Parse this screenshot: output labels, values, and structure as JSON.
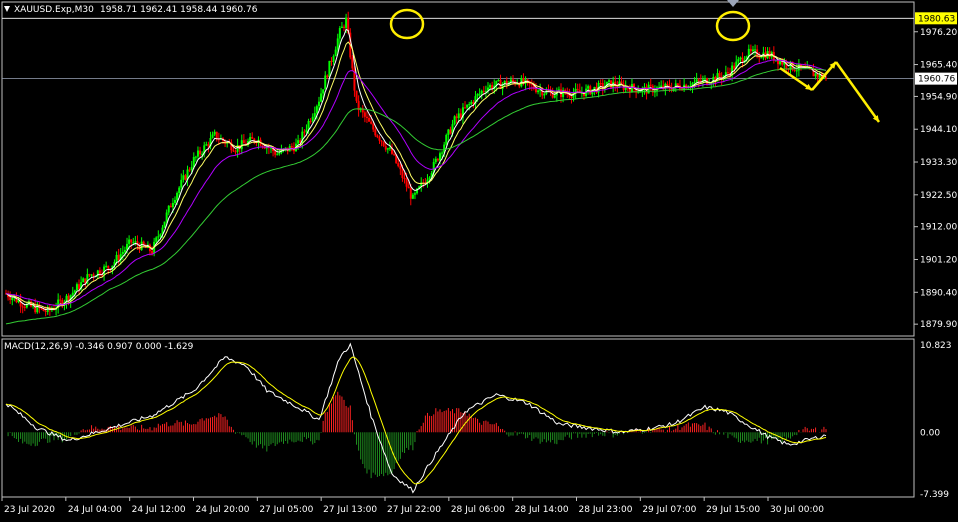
{
  "window": {
    "symbol_timeframe": "XAUUSD.Exp,M30",
    "ohlc": "1958.71 1962.41 1958.44 1960.76"
  },
  "price_axis": {
    "ticks": [
      "1976.20",
      "1965.40",
      "1954.90",
      "1944.10",
      "1933.30",
      "1922.50",
      "1912.00",
      "1901.20",
      "1890.40",
      "1879.90"
    ],
    "tick_values": [
      1976.2,
      1965.4,
      1954.9,
      1944.1,
      1933.3,
      1922.5,
      1912.0,
      1901.2,
      1890.4,
      1879.9
    ],
    "high_label": "1980.63",
    "current_label": "1960.76"
  },
  "macd": {
    "label": "MACD(12,26,9) -0.346 0.907 0.000 -1.629",
    "axis_ticks": [
      "10.823",
      "0.00",
      "-7.399"
    ],
    "axis_values": [
      10.823,
      0.0,
      -7.399
    ]
  },
  "time_axis": {
    "labels": [
      "23 Jul 2020",
      "24 Jul 04:00",
      "24 Jul 12:00",
      "24 Jul 20:00",
      "27 Jul 05:00",
      "27 Jul 13:00",
      "27 Jul 22:00",
      "28 Jul 06:00",
      "28 Jul 14:00",
      "28 Jul 23:00",
      "29 Jul 07:00",
      "29 Jul 15:00",
      "30 Jul 00:00"
    ]
  },
  "colors": {
    "background": "#000000",
    "grid": "#ffffff",
    "bull_candle": "#00ff00",
    "bear_candle": "#ff0000",
    "ma_fast": "#ffffff",
    "ma_mid": "#ffff66",
    "ma_slow": "#b000ff",
    "ma_long": "#33cc33",
    "macd_line": "#ffffff",
    "signal_line": "#ffff00",
    "hist_positive": "#ff2222",
    "hist_negative": "#1f8f1f",
    "annotation": "#ffee00",
    "high_label_bg": "#ffff00"
  },
  "chart_data": {
    "type": "candlestick",
    "title": "XAUUSD.Exp,M30",
    "ylim": [
      1876.0,
      1986.0
    ],
    "anchors": [
      [
        0,
        1890
      ],
      [
        10,
        1886
      ],
      [
        20,
        1884
      ],
      [
        30,
        1889
      ],
      [
        40,
        1896
      ],
      [
        50,
        1899
      ],
      [
        60,
        1907
      ],
      [
        70,
        1904
      ],
      [
        80,
        1921
      ],
      [
        90,
        1934
      ],
      [
        100,
        1942
      ],
      [
        110,
        1938
      ],
      [
        120,
        1941
      ],
      [
        130,
        1936
      ],
      [
        140,
        1939
      ],
      [
        150,
        1954
      ],
      [
        160,
        1976
      ],
      [
        163,
        1980
      ],
      [
        168,
        1952
      ],
      [
        175,
        1945
      ],
      [
        185,
        1936
      ],
      [
        195,
        1921
      ],
      [
        205,
        1932
      ],
      [
        215,
        1947
      ],
      [
        230,
        1958
      ],
      [
        245,
        1960
      ],
      [
        260,
        1956
      ],
      [
        275,
        1956
      ],
      [
        290,
        1959
      ],
      [
        305,
        1957
      ],
      [
        320,
        1958
      ],
      [
        335,
        1960
      ],
      [
        345,
        1962
      ],
      [
        355,
        1969
      ],
      [
        365,
        1969
      ],
      [
        375,
        1965
      ],
      [
        385,
        1963
      ],
      [
        393,
        1960.76
      ]
    ],
    "macd_anchors": [
      [
        0,
        3.5
      ],
      [
        15,
        0.5
      ],
      [
        30,
        -1
      ],
      [
        50,
        0.5
      ],
      [
        70,
        2
      ],
      [
        90,
        5
      ],
      [
        105,
        9
      ],
      [
        115,
        8
      ],
      [
        125,
        5
      ],
      [
        140,
        3
      ],
      [
        150,
        1.5
      ],
      [
        160,
        9
      ],
      [
        165,
        10.5
      ],
      [
        175,
        2
      ],
      [
        185,
        -5
      ],
      [
        195,
        -7
      ],
      [
        205,
        -3
      ],
      [
        220,
        2.5
      ],
      [
        235,
        4.5
      ],
      [
        250,
        3.5
      ],
      [
        265,
        1
      ],
      [
        280,
        0.5
      ],
      [
        295,
        0
      ],
      [
        310,
        0.5
      ],
      [
        320,
        1
      ],
      [
        335,
        3
      ],
      [
        345,
        2.5
      ],
      [
        355,
        1
      ],
      [
        365,
        -0.5
      ],
      [
        375,
        -1.5
      ],
      [
        393,
        -0.35
      ]
    ],
    "candle_count": 394
  }
}
